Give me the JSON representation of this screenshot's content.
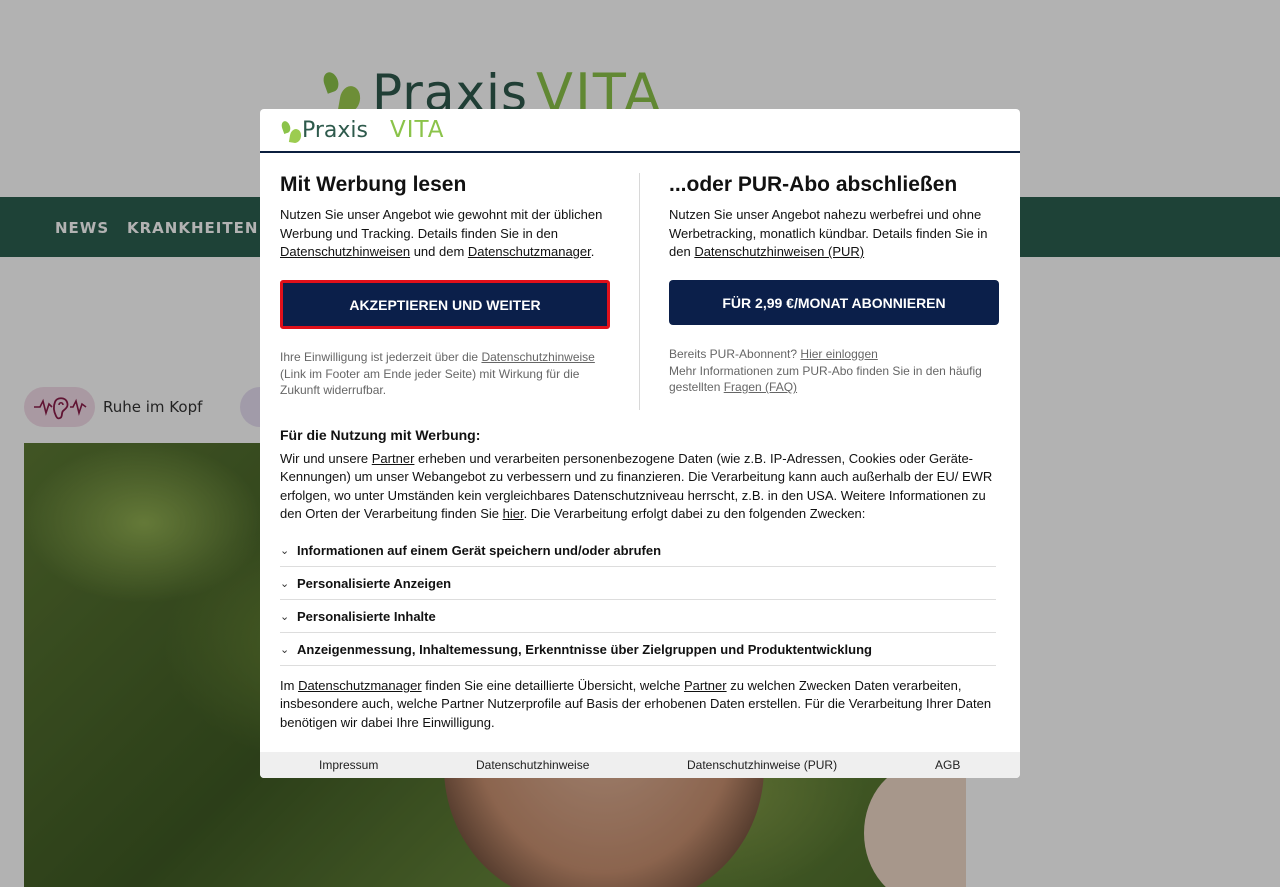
{
  "background": {
    "logo": {
      "praxis": "Praxis",
      "vita": "VITA"
    },
    "nav": {
      "items": [
        "NEWS",
        "KRANKHEITEN &"
      ]
    },
    "topic_chip": {
      "label": "Ruhe im Kopf",
      "icon": "ear-sound-icon"
    }
  },
  "modal": {
    "logo": {
      "praxis": "Praxis",
      "vita": "VITA"
    },
    "left": {
      "title": "Mit Werbung lesen",
      "text_1": "Nutzen Sie unser Angebot wie gewohnt mit der üblichen Werbung und Tracking. Details finden Sie in den ",
      "link_1": "Datenschutzhinweisen",
      "text_2": " und dem ",
      "link_2": "Datenschutzmanager",
      "text_3": ".",
      "button": "AKZEPTIEREN UND WEITER",
      "small_1": "Ihre Einwilligung ist jederzeit über die ",
      "small_link": "Datenschutzhinweise",
      "small_2": " (Link im Footer am Ende jeder Seite) mit Wirkung für die Zukunft widerrufbar."
    },
    "right": {
      "title": "...oder PUR-Abo abschließen",
      "text_1": "Nutzen Sie unser Angebot nahezu werbefrei und ohne Werbetracking, monatlich kündbar. Details finden Sie in den ",
      "link_1": "Datenschutzhinweisen (PUR)",
      "button": "FÜR 2,99 €/MONAT ABONNIEREN",
      "small_1": "Bereits PUR-Abonnent? ",
      "small_link_1": "Hier einloggen",
      "small_2": "Mehr Informationen zum PUR-Abo finden Sie in den häufig gestellten ",
      "small_link_2": "Fragen (FAQ)"
    },
    "purpose": {
      "heading": "Für die Nutzung mit Werbung:",
      "text_1": "Wir und unsere ",
      "link_1": "Partner",
      "text_2": " erheben und verarbeiten personenbezogene Daten (wie z.B. IP-Adressen, Cookies oder Geräte-Kennungen) um unser Webangebot zu verbessern und zu finanzieren. Die Verarbeitung kann auch außerhalb der EU/ EWR erfolgen, wo unter Umständen kein vergleichbares Datenschutzniveau herrscht, z.B. in den USA. Weitere Informationen zu den Orten der Verarbeitung finden Sie ",
      "link_2": "hier",
      "text_3": ". Die Verarbeitung erfolgt dabei zu den folgenden Zwecken:"
    },
    "accordion": [
      "Informationen auf einem Gerät speichern und/oder abrufen",
      "Personalisierte Anzeigen",
      "Personalisierte Inhalte",
      "Anzeigenmessung, Inhaltemessung, Erkenntnisse über Zielgruppen und Produktentwicklung"
    ],
    "bottom": {
      "text_1": "Im ",
      "link_1": "Datenschutzmanager",
      "text_2": " finden Sie eine detaillierte Übersicht, welche ",
      "link_2": "Partner",
      "text_3": " zu welchen Zwecken Daten verarbeiten, insbesondere auch, welche Partner Nutzerprofile auf Basis der erhobenen Daten erstellen. Für die Verarbeitung Ihrer Daten benötigen wir dabei Ihre Einwilligung."
    },
    "footer": [
      "Impressum",
      "Datenschutzhinweise",
      "Datenschutzhinweise (PUR)",
      "AGB"
    ]
  }
}
